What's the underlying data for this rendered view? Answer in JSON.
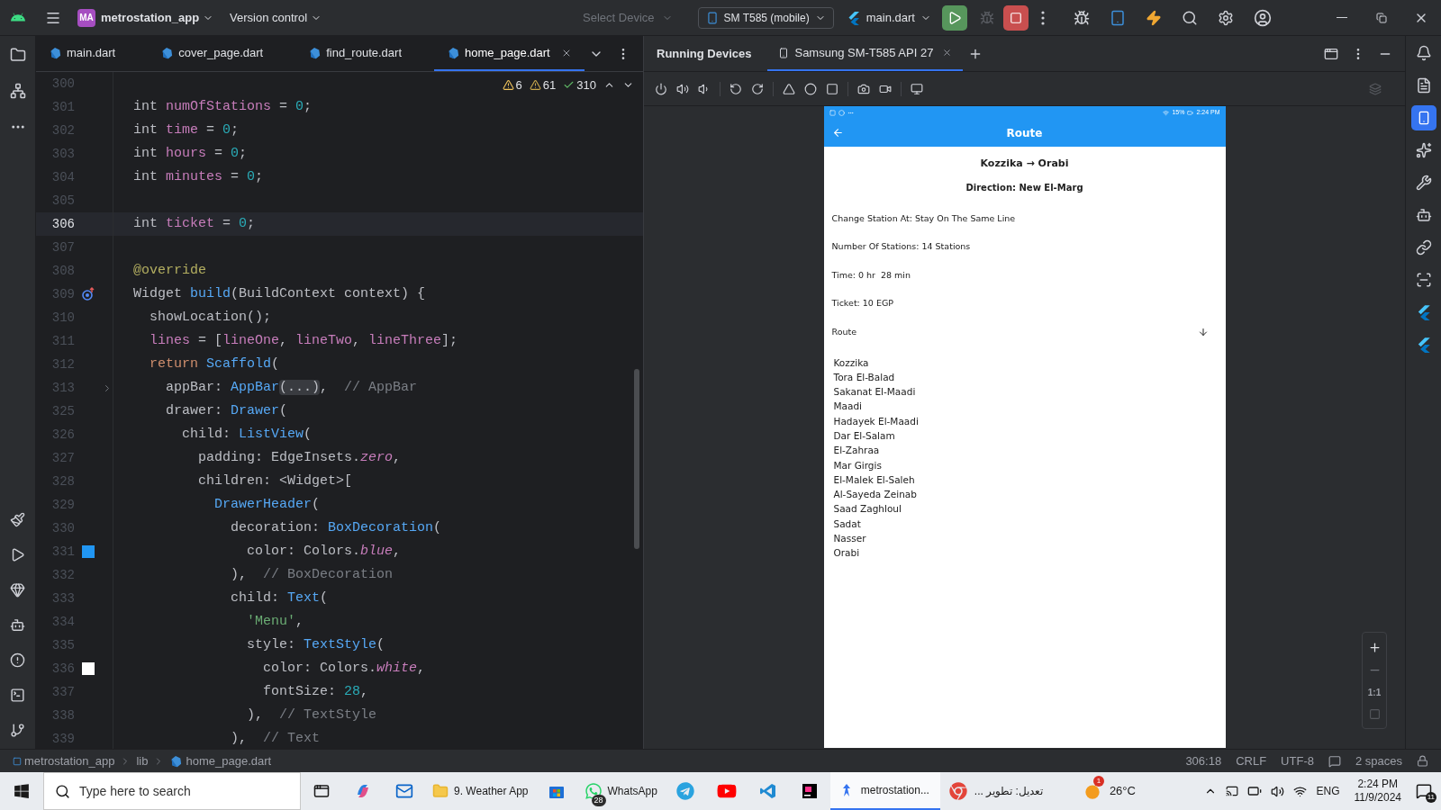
{
  "top_bar": {
    "project_badge": "MA",
    "project": "metrostation_app",
    "vcs": "Version control",
    "device_selector": {
      "placeholder": "Select Device"
    },
    "device": "SM T585 (mobile)",
    "run_config": "main.dart"
  },
  "editor": {
    "tabs": [
      {
        "label": "main.dart",
        "selected": false
      },
      {
        "label": "cover_page.dart",
        "selected": false
      },
      {
        "label": "find_route.dart",
        "selected": false
      },
      {
        "label": "home_page.dart",
        "selected": true
      }
    ],
    "problems": {
      "errors": "6",
      "warnings": "61",
      "ok": "310"
    },
    "lines": [
      {
        "number": "300",
        "current": false
      },
      {
        "number": "301",
        "current": false,
        "tokens": [
          {
            "kind": "plain",
            "text": "int "
          },
          {
            "kind": "field",
            "text": "numOfStations"
          },
          {
            "kind": "plain",
            "text": " = "
          },
          {
            "kind": "number",
            "text": "0"
          },
          {
            "kind": "plain",
            "text": ";"
          }
        ]
      },
      {
        "number": "302",
        "current": false,
        "tokens": [
          {
            "kind": "plain",
            "text": "int "
          },
          {
            "kind": "field",
            "text": "time"
          },
          {
            "kind": "plain",
            "text": " = "
          },
          {
            "kind": "number",
            "text": "0"
          },
          {
            "kind": "plain",
            "text": ";"
          }
        ]
      },
      {
        "number": "303",
        "current": false,
        "tokens": [
          {
            "kind": "plain",
            "text": "int "
          },
          {
            "kind": "field",
            "text": "hours"
          },
          {
            "kind": "plain",
            "text": " = "
          },
          {
            "kind": "number",
            "text": "0"
          },
          {
            "kind": "plain",
            "text": ";"
          }
        ]
      },
      {
        "number": "304",
        "current": false,
        "tokens": [
          {
            "kind": "plain",
            "text": "int "
          },
          {
            "kind": "field",
            "text": "minutes"
          },
          {
            "kind": "plain",
            "text": " = "
          },
          {
            "kind": "number",
            "text": "0"
          },
          {
            "kind": "plain",
            "text": ";"
          }
        ]
      },
      {
        "number": "305",
        "current": false
      },
      {
        "number": "306",
        "current": true,
        "tokens": [
          {
            "kind": "plain",
            "text": "int "
          },
          {
            "kind": "field",
            "text": "ticket"
          },
          {
            "kind": "plain",
            "text": " = "
          },
          {
            "kind": "number",
            "text": "0"
          },
          {
            "kind": "plain",
            "text": ";"
          }
        ]
      },
      {
        "number": "307",
        "current": false
      },
      {
        "number": "308",
        "current": false,
        "tokens": [
          {
            "kind": "annotation",
            "text": "@override"
          }
        ]
      },
      {
        "number": "309",
        "current": false,
        "gutter": {
          "kind": "override"
        },
        "tokens": [
          {
            "kind": "plain",
            "text": "Widget "
          },
          {
            "kind": "call",
            "text": "build"
          },
          {
            "kind": "plain",
            "text": "(BuildContext context) {"
          }
        ],
        "children": [
          {
            "number": "310",
            "current": false,
            "tokens": [
              {
                "kind": "plain",
                "text": "showLocation();"
              }
            ]
          },
          {
            "number": "311",
            "current": false,
            "tokens": [
              {
                "kind": "field",
                "text": "lines"
              },
              {
                "kind": "plain",
                "text": " = ["
              },
              {
                "kind": "field",
                "text": "lineOne"
              },
              {
                "kind": "plain",
                "text": ", "
              },
              {
                "kind": "field",
                "text": "lineTwo"
              },
              {
                "kind": "plain",
                "text": ", "
              },
              {
                "kind": "field",
                "text": "lineThree"
              },
              {
                "kind": "plain",
                "text": "];"
              }
            ]
          },
          {
            "number": "312",
            "current": false,
            "tokens": [
              {
                "kind": "keyword",
                "text": "return "
              },
              {
                "kind": "call",
                "text": "Scaffold"
              },
              {
                "kind": "plain",
                "text": "("
              }
            ],
            "children": [
              {
                "number": "313",
                "current": false,
                "gutter": {
                  "kind": "fold"
                },
                "tokens": [
                  {
                    "kind": "plain",
                    "text": "appBar: "
                  },
                  {
                    "kind": "call",
                    "text": "AppBar"
                  },
                  {
                    "kind": "folded",
                    "text": "(...)"
                  },
                  {
                    "kind": "plain",
                    "text": ",  "
                  },
                  {
                    "kind": "comment",
                    "text": "// AppBar"
                  }
                ]
              },
              {
                "number": "325",
                "current": false,
                "tokens": [
                  {
                    "kind": "plain",
                    "text": "drawer: "
                  },
                  {
                    "kind": "call",
                    "text": "Drawer"
                  },
                  {
                    "kind": "plain",
                    "text": "("
                  }
                ],
                "children": [
                  {
                    "number": "326",
                    "current": false,
                    "tokens": [
                      {
                        "kind": "plain",
                        "text": "child: "
                      },
                      {
                        "kind": "call",
                        "text": "ListView"
                      },
                      {
                        "kind": "plain",
                        "text": "("
                      }
                    ],
                    "children": [
                      {
                        "number": "327",
                        "current": false,
                        "tokens": [
                          {
                            "kind": "plain",
                            "text": "padding: EdgeInsets."
                          },
                          {
                            "kind": "constant",
                            "text": "zero"
                          },
                          {
                            "kind": "plain",
                            "text": ","
                          }
                        ]
                      },
                      {
                        "number": "328",
                        "current": false,
                        "tokens": [
                          {
                            "kind": "plain",
                            "text": "children: <Widget>["
                          }
                        ],
                        "children": [
                          {
                            "number": "329",
                            "current": false,
                            "tokens": [
                              {
                                "kind": "call",
                                "text": "DrawerHeader"
                              },
                              {
                                "kind": "plain",
                                "text": "("
                              }
                            ],
                            "children": [
                              {
                                "number": "330",
                                "current": false,
                                "tokens": [
                                  {
                                    "kind": "plain",
                                    "text": "decoration: "
                                  },
                                  {
                                    "kind": "call",
                                    "text": "BoxDecoration"
                                  },
                                  {
                                    "kind": "plain",
                                    "text": "("
                                  }
                                ],
                                "children": [
                                  {
                                    "number": "331",
                                    "current": false,
                                    "gutter": {
                                      "kind": "swatch",
                                      "color": "#2196f3"
                                    },
                                    "tokens": [
                                      {
                                        "kind": "plain",
                                        "text": "color: Colors."
                                      },
                                      {
                                        "kind": "constant",
                                        "text": "blue"
                                      },
                                      {
                                        "kind": "plain",
                                        "text": ","
                                      }
                                    ]
                                  }
                                ]
                              },
                              {
                                "number": "332",
                                "current": false,
                                "tokens": [
                                  {
                                    "kind": "plain",
                                    "text": "),  "
                                  },
                                  {
                                    "kind": "comment",
                                    "text": "// BoxDecoration"
                                  }
                                ]
                              },
                              {
                                "number": "333",
                                "current": false,
                                "tokens": [
                                  {
                                    "kind": "plain",
                                    "text": "child: "
                                  },
                                  {
                                    "kind": "call",
                                    "text": "Text"
                                  },
                                  {
                                    "kind": "plain",
                                    "text": "("
                                  }
                                ],
                                "children": [
                                  {
                                    "number": "334",
                                    "current": false,
                                    "tokens": [
                                      {
                                        "kind": "string",
                                        "text": "'Menu'"
                                      },
                                      {
                                        "kind": "plain",
                                        "text": ","
                                      }
                                    ]
                                  },
                                  {
                                    "number": "335",
                                    "current": false,
                                    "tokens": [
                                      {
                                        "kind": "plain",
                                        "text": "style: "
                                      },
                                      {
                                        "kind": "call",
                                        "text": "TextStyle"
                                      },
                                      {
                                        "kind": "plain",
                                        "text": "("
                                      }
                                    ],
                                    "children": [
                                      {
                                        "number": "336",
                                        "current": false,
                                        "gutter": {
                                          "kind": "swatch",
                                          "color": "#ffffff"
                                        },
                                        "tokens": [
                                          {
                                            "kind": "plain",
                                            "text": "color: Colors."
                                          },
                                          {
                                            "kind": "constant",
                                            "text": "white"
                                          },
                                          {
                                            "kind": "plain",
                                            "text": ","
                                          }
                                        ]
                                      },
                                      {
                                        "number": "337",
                                        "current": false,
                                        "tokens": [
                                          {
                                            "kind": "plain",
                                            "text": "fontSize: "
                                          },
                                          {
                                            "kind": "number",
                                            "text": "28"
                                          },
                                          {
                                            "kind": "plain",
                                            "text": ","
                                          }
                                        ]
                                      }
                                    ]
                                  },
                                  {
                                    "number": "338",
                                    "current": false,
                                    "tokens": [
                                      {
                                        "kind": "plain",
                                        "text": "),  "
                                      },
                                      {
                                        "kind": "comment",
                                        "text": "// TextStyle"
                                      }
                                    ]
                                  }
                                ]
                              },
                              {
                                "number": "339",
                                "current": false,
                                "tokens": [
                                  {
                                    "kind": "plain",
                                    "text": "),  "
                                  },
                                  {
                                    "kind": "comment",
                                    "text": "// Text"
                                  }
                                ]
                              }
                            ]
                          }
                        ]
                      }
                    ]
                  }
                ]
              }
            ]
          }
        ]
      }
    ]
  },
  "devices": {
    "title": "Running Devices",
    "tabs": [
      {
        "label": "Samsung SM-T585 API 27",
        "selected": true
      }
    ],
    "zoom_reset": "1:1",
    "phone": {
      "battery": "15%",
      "time": "2:24 PM",
      "app_bar_title": "Route",
      "heading": "Kozzika → Orabi",
      "direction": "Direction: New El-Marg",
      "details": [
        "Change Station At: Stay On The Same Line",
        "Number Of Stations: 14 Stations",
        "Time: 0 hr  28 min",
        "Ticket: 10 EGP"
      ],
      "route_label": "Route",
      "stations": [
        "Kozzika",
        "Tora El-Balad",
        "Sakanat El-Maadi",
        "Maadi",
        "Hadayek El-Maadi",
        "Dar El-Salam",
        "El-Zahraa",
        "Mar Girgis",
        "El-Malek El-Saleh",
        "Al-Sayeda Zeinab",
        "Saad Zaghloul",
        "Sadat",
        "Nasser",
        "Orabi"
      ]
    }
  },
  "status_bar": {
    "breadcrumbs": [
      "metrostation_app",
      "lib",
      "home_page.dart"
    ],
    "caret": "306:18",
    "line_separator": "CRLF",
    "encoding": "UTF-8",
    "indent": "2 spaces"
  },
  "taskbar": {
    "search": {
      "placeholder": "Type here to search"
    },
    "folder": {
      "label": "9. Weather App"
    },
    "whatsapp": {
      "label": "WhatsApp",
      "badge": "28"
    },
    "ide": {
      "label": "metrostation...",
      "selected": true
    },
    "browser": {
      "label": "تعديل: تطوير ..."
    },
    "weather": {
      "badge": "1",
      "temperature": "26°C"
    },
    "tray": {
      "language": "ENG",
      "time": "2:24 PM",
      "date": "11/9/2024",
      "notifications": "11"
    }
  }
}
